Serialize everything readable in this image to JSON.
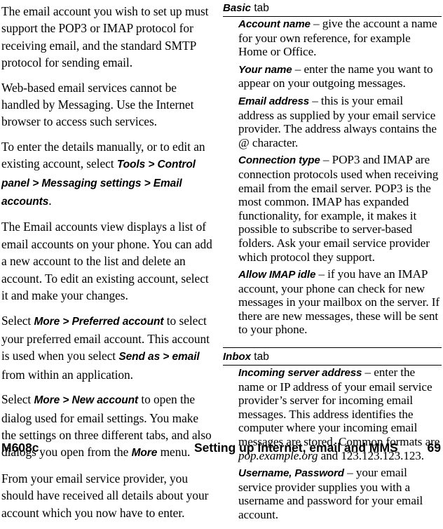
{
  "page": {
    "number": "69",
    "model": "M608c",
    "footer_title": "Setting up Internet, email and MMS"
  },
  "left_column": {
    "paragraphs": [
      {
        "id": "p-protocol-support",
        "runs": [
          {
            "type": "text",
            "text": "The email account you wish to set up must support the POP3 or IMAP protocol for receiving email, and the standard SMTP protocol for sending email."
          }
        ]
      },
      {
        "id": "p-webmail-note",
        "runs": [
          {
            "type": "text",
            "text": "Web-based email services cannot be handled by Messaging. Use the Internet browser to access such services."
          }
        ]
      },
      {
        "id": "p-manual-entry",
        "runs": [
          {
            "type": "text",
            "text": "To enter the details manually, or to edit an existing account, select "
          },
          {
            "type": "ui",
            "text": "Tools > Control panel > Messaging settings > Email accounts"
          },
          {
            "type": "text",
            "text": "."
          }
        ]
      },
      {
        "id": "p-accounts-view",
        "runs": [
          {
            "type": "text",
            "text": "The Email accounts view displays a list of email accounts on your phone. You can add a new account to the list and delete an account. To edit an existing account, select it and make your changes."
          }
        ]
      },
      {
        "id": "p-preferred-account",
        "runs": [
          {
            "type": "text",
            "text": "Select "
          },
          {
            "type": "ui",
            "text": "More > Preferred account"
          },
          {
            "type": "text",
            "text": " to select your preferred email account. This account is used when you select "
          },
          {
            "type": "ui",
            "text": "Send as > email"
          },
          {
            "type": "text",
            "text": " from within an application."
          }
        ]
      },
      {
        "id": "p-new-account",
        "runs": [
          {
            "type": "text",
            "text": "Select "
          },
          {
            "type": "ui",
            "text": "More > New account"
          },
          {
            "type": "text",
            "text": " to open the dialog used for email settings. You make the settings on three different tabs, and also dialogs you open from the "
          },
          {
            "type": "ui",
            "text": "More"
          },
          {
            "type": "text",
            "text": " menu."
          }
        ]
      },
      {
        "id": "p-provider-details",
        "runs": [
          {
            "type": "text",
            "text": "From your email service provider, you should have received all details about your account which you now have to enter."
          }
        ]
      }
    ]
  },
  "right_column": {
    "sections": [
      {
        "id": "section-basic",
        "heading_term": "Basic",
        "heading_word": " tab",
        "items": [
          {
            "id": "item-account-name",
            "runs": [
              {
                "type": "term",
                "text": "Account name"
              },
              {
                "type": "text",
                "text": " – give the account a name for your own reference, for example Home or Office."
              }
            ]
          },
          {
            "id": "item-your-name",
            "runs": [
              {
                "type": "term",
                "text": "Your name"
              },
              {
                "type": "text",
                "text": " – enter the name you want to appear on your outgoing messages."
              }
            ]
          },
          {
            "id": "item-email-address",
            "runs": [
              {
                "type": "term",
                "text": "Email address"
              },
              {
                "type": "text",
                "text": " – this is your email address as supplied by your email service provider. The address always contains the @ character."
              }
            ]
          },
          {
            "id": "item-connection-type",
            "runs": [
              {
                "type": "term",
                "text": "Connection type"
              },
              {
                "type": "text",
                "text": " – POP3 and IMAP are connection protocols used when receiving email from the email server. POP3 is the most common. IMAP has expanded functionality, for example, it makes it possible to subscribe to server-based folders. Ask your email service provider which protocol they support."
              }
            ]
          },
          {
            "id": "item-allow-imap-idle",
            "runs": [
              {
                "type": "term",
                "text": "Allow IMAP idle"
              },
              {
                "type": "text",
                "text": " – if you have an IMAP account, your phone can check for new messages in your mailbox on the server. If there are new messages, these will be sent to your phone."
              }
            ]
          }
        ]
      },
      {
        "id": "section-inbox",
        "heading_term": "Inbox",
        "heading_word": " tab",
        "items": [
          {
            "id": "item-incoming-server-address",
            "runs": [
              {
                "type": "term",
                "text": "Incoming server address"
              },
              {
                "type": "text",
                "text": " – enter the name or IP address of your email service provider’s server for incoming email messages. This address identifies the computer where your incoming email messages are stored. Common formats are "
              },
              {
                "type": "italic",
                "text": "pop.example.org"
              },
              {
                "type": "text",
                "text": " and 123.123.123.123."
              }
            ]
          },
          {
            "id": "item-username-password",
            "runs": [
              {
                "type": "term",
                "text": "Username, Password"
              },
              {
                "type": "text",
                "text": " – your email service provider supplies you with a username and password for your email account."
              }
            ]
          }
        ]
      }
    ]
  }
}
